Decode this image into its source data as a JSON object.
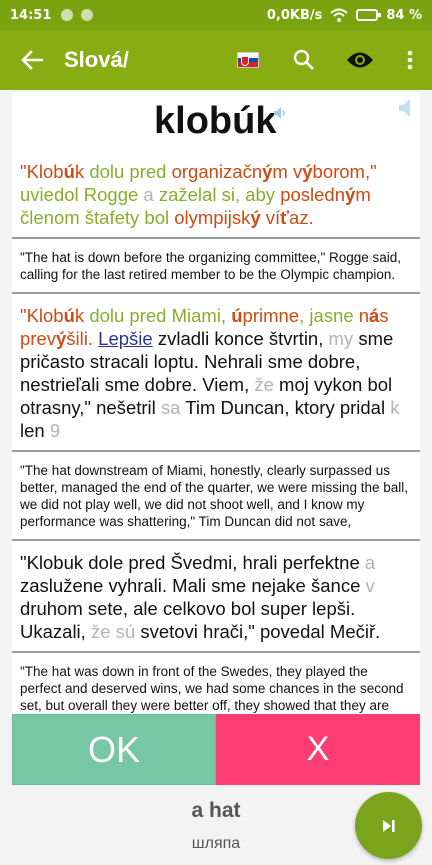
{
  "status_bar": {
    "time": "14:51",
    "network": "0,0KB/s",
    "battery": "84 %"
  },
  "toolbar": {
    "title": "Slová/",
    "back_icon": "arrow-left-icon",
    "flag_icon": "slovakia-flag-icon",
    "search_icon": "search-icon",
    "eye_icon": "eye-icon",
    "menu_icon": "more-vert-icon"
  },
  "card": {
    "word": "klobúk",
    "examples": [
      {
        "sentence": [
          {
            "t": "\"Klob",
            "c": "red"
          },
          {
            "t": "ú",
            "c": "red",
            "b": true
          },
          {
            "t": "k ",
            "c": "red"
          },
          {
            "t": "dolu pred ",
            "c": "grn"
          },
          {
            "t": "organizačn",
            "c": "red"
          },
          {
            "t": "ý",
            "c": "red",
            "b": true
          },
          {
            "t": "m v",
            "c": "red"
          },
          {
            "t": "ý",
            "c": "red",
            "b": true
          },
          {
            "t": "borom,\"",
            "c": "red"
          },
          {
            "t": " uviedol Rogge ",
            "c": "grn"
          },
          {
            "t": "a ",
            "c": "gry"
          },
          {
            "t": "zaželal si, aby ",
            "c": "grn"
          },
          {
            "t": "posledn",
            "c": "red"
          },
          {
            "t": "ý",
            "c": "red",
            "b": true
          },
          {
            "t": "m ",
            "c": "red"
          },
          {
            "t": "členom štafety bol ",
            "c": "grn"
          },
          {
            "t": "olympijsk",
            "c": "red"
          },
          {
            "t": "ý",
            "c": "red",
            "b": true
          },
          {
            "t": " ví",
            "c": "red"
          },
          {
            "t": "ť",
            "c": "red",
            "b": true
          },
          {
            "t": "az.",
            "c": "red"
          }
        ],
        "translation": "\"The hat is down before the organizing committee,\" Rogge said, calling for the last retired member to be the Olympic champion."
      },
      {
        "sentence": [
          {
            "t": "\"Klob",
            "c": "red"
          },
          {
            "t": "ú",
            "c": "red",
            "b": true
          },
          {
            "t": "k ",
            "c": "red"
          },
          {
            "t": "dolu pred Miami, ",
            "c": "grn"
          },
          {
            "t": "ú",
            "c": "red",
            "b": true
          },
          {
            "t": "primne",
            "c": "red"
          },
          {
            "t": ", ",
            "c": "grn"
          },
          {
            "t": "jasne ",
            "c": "grn"
          },
          {
            "t": "n",
            "c": "red"
          },
          {
            "t": "á",
            "c": "red",
            "b": true
          },
          {
            "t": "s ",
            "c": "red"
          },
          {
            "t": "prev",
            "c": "red"
          },
          {
            "t": "ý",
            "c": "red",
            "b": true
          },
          {
            "t": "šili. ",
            "c": "red"
          },
          {
            "t": "Lepšie",
            "c": "link"
          },
          {
            "t": " zvladli konce štvrtin, ",
            "c": "blk"
          },
          {
            "t": "my ",
            "c": "gry"
          },
          {
            "t": "sme pričasto stracali loptu. Nehrali sme dobre, nestrieľali sme dobre. Viem, ",
            "c": "blk"
          },
          {
            "t": "že ",
            "c": "gry"
          },
          {
            "t": "moj vykon bol otrasny,\" nešetril ",
            "c": "blk"
          },
          {
            "t": "sa ",
            "c": "gry"
          },
          {
            "t": "Tim Duncan, ktory pridal ",
            "c": "blk"
          },
          {
            "t": "k ",
            "c": "gry"
          },
          {
            "t": "len ",
            "c": "blk"
          },
          {
            "t": "9",
            "c": "gry"
          }
        ],
        "translation": "\"The hat downstream of Miami, honestly, clearly surpassed us better, managed the end of the quarter, we were missing the ball, we did not play well, we did not shoot well, and I know my performance was shattering,\" Tim Duncan did not save,"
      },
      {
        "sentence": [
          {
            "t": "\"Klobuk dole pred Švedmi, hrali perfektne ",
            "c": "blk"
          },
          {
            "t": "a ",
            "c": "gry"
          },
          {
            "t": "zaslužene vyhrali. Mali sme nejake šance ",
            "c": "blk"
          },
          {
            "t": "v ",
            "c": "gry"
          },
          {
            "t": "druhom sete, ale celkovo bol super lepši. Ukazali, ",
            "c": "blk"
          },
          {
            "t": "že sú ",
            "c": "gry"
          },
          {
            "t": "svetovi hrači,\" povedal Mečiř.",
            "c": "blk"
          }
        ],
        "translation": "\"The hat was down in front of the Swedes, they played the perfect and deserved wins, we had some chances in the second set, but overall they were better off, they showed that they are world"
      }
    ]
  },
  "buttons": {
    "ok": "OK",
    "no": "X"
  },
  "bottom": {
    "word": "a hat",
    "translation": "шляпа",
    "fab_icon": "skip-next-icon"
  },
  "colors": {
    "toolbar": "#87ad13",
    "status": "#7aa30f",
    "ok": "#77c6a5",
    "no": "#fc3d73",
    "red": "#cf4a12",
    "green": "#8aac2c",
    "fab": "#79a41b"
  }
}
